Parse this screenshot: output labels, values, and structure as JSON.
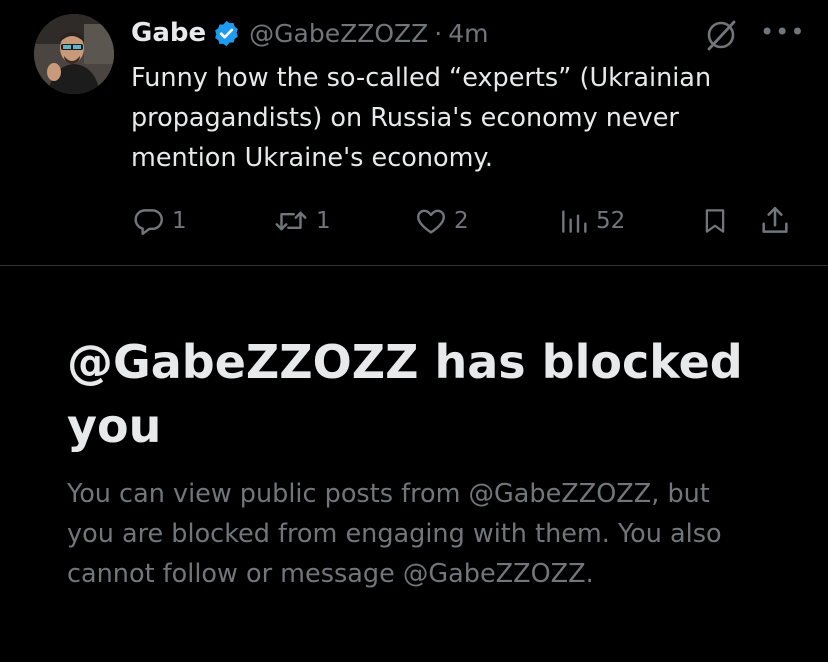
{
  "tweet": {
    "author_name": "Gabe",
    "author_handle": "@GabeZZOZZ",
    "separator": "·",
    "time_ago": "4m",
    "text_lines": [
      "Funny how the so-called “experts” (Ukrainian",
      "propagandists) on Russia's economy never",
      "mention Ukraine's economy."
    ],
    "stats": {
      "replies": "1",
      "reposts": "1",
      "likes": "2",
      "views": "52"
    }
  },
  "blocked": {
    "title_line1": "@GabeZZOZZ has blocked",
    "title_line2": "you",
    "message_lines": [
      "You can view public posts from @GabeZZOZZ, but",
      "you are blocked from engaging with them. You also",
      "cannot follow or message @GabeZZOZZ."
    ]
  },
  "colors": {
    "background": "#000000",
    "primary_text": "#e7e9ea",
    "secondary_text": "#71767b",
    "verified_badge": "#1d9bf0",
    "divider": "#2f3336"
  },
  "icons": [
    "verified-badge-icon",
    "grok-icon",
    "more-icon",
    "reply-icon",
    "repost-icon",
    "like-icon",
    "views-icon",
    "bookmark-icon",
    "share-icon"
  ]
}
